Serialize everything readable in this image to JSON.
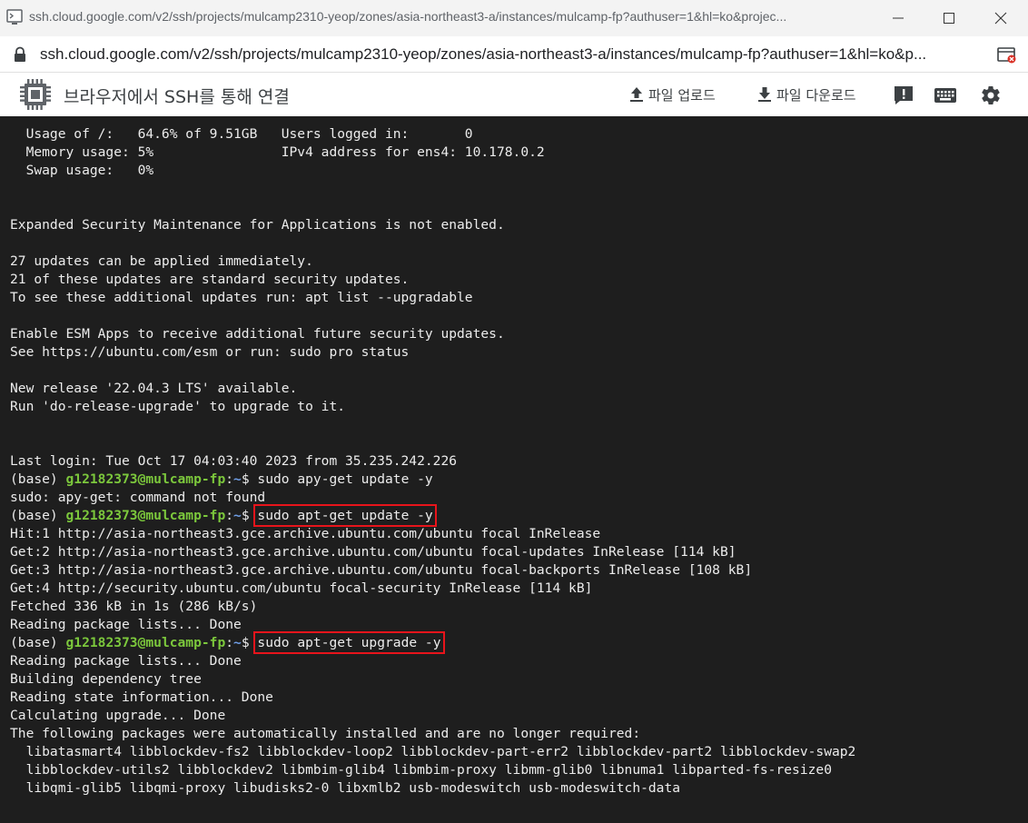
{
  "window": {
    "title": "ssh.cloud.google.com/v2/ssh/projects/mulcamp2310-yeop/zones/asia-northeast3-a/instances/mulcamp-fp?authuser=1&hl=ko&projec...",
    "icons": [
      "app-icon",
      "minimize-icon",
      "maximize-icon",
      "close-icon"
    ]
  },
  "address": {
    "url": "ssh.cloud.google.com/v2/ssh/projects/mulcamp2310-yeop/zones/asia-northeast3-a/instances/mulcamp-fp?authuser=1&hl=ko&p...",
    "icons": [
      "lock-icon",
      "cast-icon"
    ]
  },
  "toolbar": {
    "title": "브라우저에서 SSH를 통해 연결",
    "upload_label": "파일 업로드",
    "download_label": "파일 다운로드",
    "icons": [
      "chip-icon",
      "upload-icon",
      "download-icon",
      "help-icon",
      "keyboard-icon",
      "settings-icon"
    ]
  },
  "terminal": {
    "colors": {
      "background": "#1e1e1e",
      "text": "#ececec",
      "user": "#7cc83c",
      "path": "#6f9ee6",
      "highlight": "#e8141b"
    },
    "prompt": {
      "prefix": "(base) ",
      "user": "g12182373@mulcamp-fp",
      "sep": ":",
      "path": "~",
      "symbol": "$ "
    },
    "lines": [
      {
        "t": "text",
        "text": "  Usage of /:   64.6% of 9.51GB   Users logged in:       0"
      },
      {
        "t": "text",
        "text": "  Memory usage: 5%                IPv4 address for ens4: 10.178.0.2"
      },
      {
        "t": "text",
        "text": "  Swap usage:   0%"
      },
      {
        "t": "text",
        "text": ""
      },
      {
        "t": "text",
        "text": ""
      },
      {
        "t": "text",
        "text": "Expanded Security Maintenance for Applications is not enabled."
      },
      {
        "t": "text",
        "text": ""
      },
      {
        "t": "text",
        "text": "27 updates can be applied immediately."
      },
      {
        "t": "text",
        "text": "21 of these updates are standard security updates."
      },
      {
        "t": "text",
        "text": "To see these additional updates run: apt list --upgradable"
      },
      {
        "t": "text",
        "text": ""
      },
      {
        "t": "text",
        "text": "Enable ESM Apps to receive additional future security updates."
      },
      {
        "t": "text",
        "text": "See https://ubuntu.com/esm or run: sudo pro status"
      },
      {
        "t": "text",
        "text": ""
      },
      {
        "t": "text",
        "text": "New release '22.04.3 LTS' available."
      },
      {
        "t": "text",
        "text": "Run 'do-release-upgrade' to upgrade to it."
      },
      {
        "t": "text",
        "text": ""
      },
      {
        "t": "text",
        "text": ""
      },
      {
        "t": "text",
        "text": "Last login: Tue Oct 17 04:03:40 2023 from 35.235.242.226"
      },
      {
        "t": "prompt",
        "cmd": "sudo apy-get update -y",
        "highlight": false
      },
      {
        "t": "text",
        "text": "sudo: apy-get: command not found"
      },
      {
        "t": "prompt",
        "cmd": "sudo apt-get update -y",
        "highlight": true
      },
      {
        "t": "text",
        "text": "Hit:1 http://asia-northeast3.gce.archive.ubuntu.com/ubuntu focal InRelease"
      },
      {
        "t": "text",
        "text": "Get:2 http://asia-northeast3.gce.archive.ubuntu.com/ubuntu focal-updates InRelease [114 kB]"
      },
      {
        "t": "text",
        "text": "Get:3 http://asia-northeast3.gce.archive.ubuntu.com/ubuntu focal-backports InRelease [108 kB]"
      },
      {
        "t": "text",
        "text": "Get:4 http://security.ubuntu.com/ubuntu focal-security InRelease [114 kB]"
      },
      {
        "t": "text",
        "text": "Fetched 336 kB in 1s (286 kB/s)"
      },
      {
        "t": "text",
        "text": "Reading package lists... Done"
      },
      {
        "t": "prompt",
        "cmd": "sudo apt-get upgrade -y",
        "highlight": true
      },
      {
        "t": "text",
        "text": "Reading package lists... Done"
      },
      {
        "t": "text",
        "text": "Building dependency tree"
      },
      {
        "t": "text",
        "text": "Reading state information... Done"
      },
      {
        "t": "text",
        "text": "Calculating upgrade... Done"
      },
      {
        "t": "text",
        "text": "The following packages were automatically installed and are no longer required:"
      },
      {
        "t": "text",
        "text": "  libatasmart4 libblockdev-fs2 libblockdev-loop2 libblockdev-part-err2 libblockdev-part2 libblockdev-swap2"
      },
      {
        "t": "text",
        "text": "  libblockdev-utils2 libblockdev2 libmbim-glib4 libmbim-proxy libmm-glib0 libnuma1 libparted-fs-resize0"
      },
      {
        "t": "text",
        "text": "  libqmi-glib5 libqmi-proxy libudisks2-0 libxmlb2 usb-modeswitch usb-modeswitch-data"
      }
    ]
  }
}
